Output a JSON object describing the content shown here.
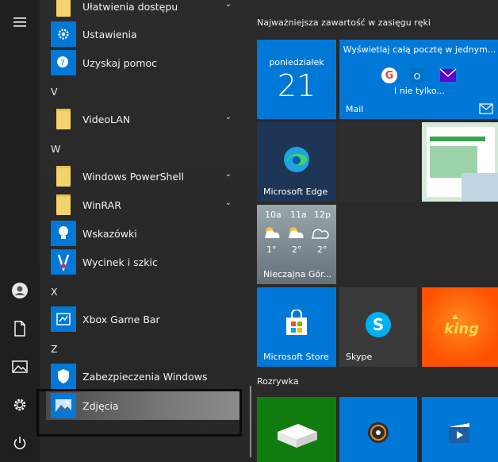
{
  "rail": {
    "menu_icon": "hamburger-icon",
    "user_icon": "user-icon",
    "documents_icon": "document-icon",
    "pictures_icon": "pictures-icon",
    "settings_icon": "gear-icon",
    "power_icon": "power-icon"
  },
  "apps": {
    "ulatwienia": "Ułatwienia dostępu",
    "ustawienia": "Ustawienia",
    "pomoc": "Uzyskaj pomoc",
    "letter_v": "V",
    "videolan": "VideoLAN",
    "letter_w": "W",
    "powershell": "Windows PowerShell",
    "winrar": "WinRAR",
    "wskazowki": "Wskazówki",
    "wycinek": "Wycinek i szkic",
    "letter_x": "X",
    "xbox": "Xbox Game Bar",
    "letter_z": "Z",
    "zabezpieczenia": "Zabezpieczenia Windows",
    "zdjecia": "Zdjęcia"
  },
  "tiles": {
    "group1_title": "Najważniejsza zawartość w zasięgu ręki",
    "calendar_day": "poniedziałek",
    "calendar_date": "21",
    "mail_text": "Wyświetlaj całą pocztę w jednym...",
    "mail_more": "I nie tylko...",
    "mail_label": "Mail",
    "edge_label": "Microsoft Edge",
    "weather_h1": "10a",
    "weather_h2": "11a",
    "weather_h3": "12p",
    "weather_t1": "1°",
    "weather_t2": "2°",
    "weather_t3": "2°",
    "weather_label": "Nieczajna Gór...",
    "store_label": "Microsoft Store",
    "skype_label": "Skype",
    "group2_title": "Rozrywka",
    "accent_calendar": "#0078d7",
    "accent_skype": "#3a3a3a",
    "accent_king": "#ff5a00",
    "accent_xbox": "#107c10"
  }
}
